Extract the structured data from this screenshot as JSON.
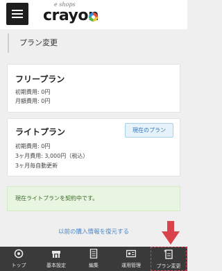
{
  "header": {
    "logo_tagline": "e shops",
    "logo_text": "crayon"
  },
  "page": {
    "title": "プラン変更"
  },
  "plans": [
    {
      "name": "フリープラン",
      "details": [
        "初期費用: 0円",
        "月額費用: 0円"
      ]
    },
    {
      "name": "ライトプラン",
      "current_label": "現在のプラン",
      "details": [
        "初期費用: 0円",
        "3ヶ月費用: 3,000円（税込）",
        "3ヶ月毎自動更新"
      ]
    }
  ],
  "notice": "現在ライトプランを契約中です。",
  "restore_link": "以前の購入情報を復元する",
  "bottom_nav": [
    {
      "label": "トップ",
      "icon": "dashboard-icon"
    },
    {
      "label": "基本設定",
      "icon": "store-icon"
    },
    {
      "label": "編集",
      "icon": "document-icon"
    },
    {
      "label": "運用管理",
      "icon": "id-card-icon"
    },
    {
      "label": "プラン変更",
      "icon": "plan-document-icon",
      "active": true
    }
  ],
  "colors": {
    "accent_blue": "#4a86c7",
    "notice_bg": "#e8f5e0",
    "arrow_red": "#d9434b",
    "nav_bg": "#3a3a3a"
  }
}
